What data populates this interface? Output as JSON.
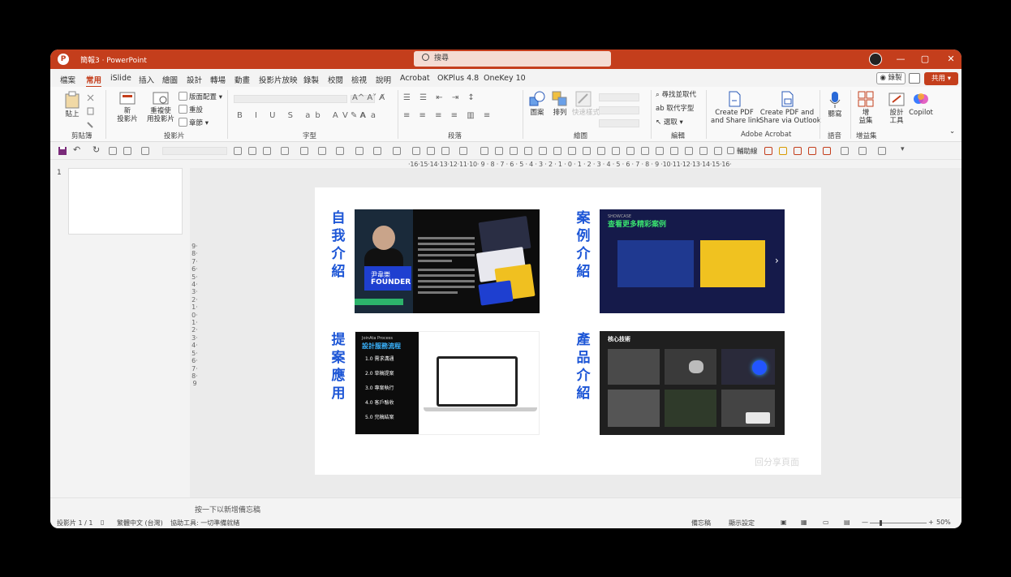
{
  "titlebar": {
    "doc_title": "簡報3 · PowerPoint",
    "search_placeholder": "搜尋",
    "win_minimize": "—",
    "win_maximize": "▢",
    "win_close": "✕"
  },
  "tabs": [
    "檔案",
    "常用",
    "iSlide",
    "插入",
    "繪圖",
    "設計",
    "轉場",
    "動畫",
    "投影片放映",
    "錄製",
    "校閱",
    "檢視",
    "說明",
    "Acrobat",
    "OKPlus 4.8",
    "OneKey 10"
  ],
  "active_tab": "常用",
  "tab_actions": {
    "record": "◉ 錄製",
    "share": "共用 ▾"
  },
  "ribbon": {
    "clipboard": {
      "paste": "貼上",
      "group": "剪貼簿"
    },
    "slides": {
      "new_slide": "新\n投影片",
      "reuse": "重複使\n用投影片",
      "layout": "版面配置",
      "reset": "重設",
      "section": "章節",
      "group": "投影片"
    },
    "font_group": "字型",
    "paragraph_group": "段落",
    "drawing": {
      "shapes": "圖案",
      "arrange": "排列",
      "quick_styles": "快速樣式",
      "group": "繪圖"
    },
    "editing": {
      "find": "尋找並取代",
      "replace": "取代字型",
      "select": "選取",
      "group": "編輯"
    },
    "acrobat": {
      "create_share": "Create PDF\nand Share link",
      "create_outlook": "Create PDF and\nShare via Outlook",
      "group": "Adobe Acrobat"
    },
    "voice": {
      "dictate": "聽寫",
      "group": "語音"
    },
    "addins": {
      "addins": "增\n益集",
      "group": "增益集"
    },
    "designer": {
      "label": "設計\n工具"
    },
    "copilot": {
      "label": "Copilot"
    }
  },
  "qat": {
    "checkbox_label": "輔助線"
  },
  "ruler": "·16·15·14·13·12·11·10· 9 · 8 · 7 · 6 · 5 · 4 · 3 · 2 · 1 · 0 · 1 · 2 · 3 · 4 · 5 · 6 · 7 · 8 · 9 ·10·11·12·13·14·15·16·",
  "vruler": "9·8·7·6·5·4·3·2·1·0·1·2·3·4·5·6·7·8·9",
  "thumbnails": {
    "slide_number": "1"
  },
  "slide": {
    "labels": {
      "about": "自我介紹",
      "cases": "案例介紹",
      "proposal": "提案應用",
      "product": "產品介紹"
    },
    "card1": {
      "name": "尹韋樂",
      "role": "FOUNDER"
    },
    "card2": {
      "header_small": "SHOWCASE",
      "header": "查看更多精彩案例"
    },
    "card3": {
      "title_small": "JoinAta Process",
      "title": "設計服務流程",
      "steps": [
        "1.0 需求溝通",
        "2.0 草稿提案",
        "3.0 專案執行",
        "4.0 客戶驗收",
        "5.0 完稿結案"
      ]
    },
    "card4": {
      "title": "核心技術"
    },
    "watermark": "回分享頁面"
  },
  "notes": {
    "placeholder": "按一下以新增備忘稿"
  },
  "status": {
    "slide_count": "投影片 1 / 1",
    "language": "繁體中文 (台灣)",
    "accessibility": "協助工具: 一切準備就緒",
    "notes": "備忘稿",
    "display": "顯示設定",
    "zoom_minus": "—",
    "zoom_plus": "+",
    "zoom": "50%"
  },
  "colors": {
    "accent": "#c43e1c",
    "slide_label": "#1d56d6"
  }
}
